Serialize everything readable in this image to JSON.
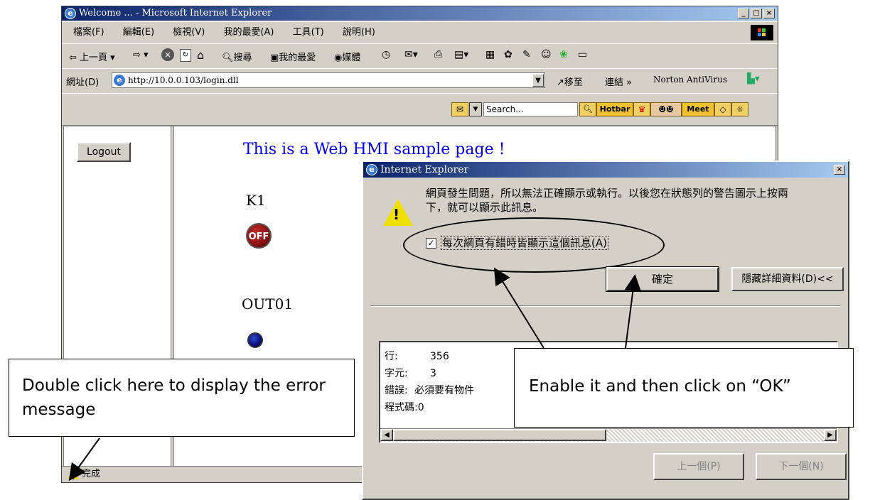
{
  "browser": {
    "title": "Welcome ... - Microsoft Internet Explorer",
    "menu": [
      "檔案(F)",
      "編輯(E)",
      "檢視(V)",
      "我的最愛(A)",
      "工具(T)",
      "說明(H)"
    ],
    "toolbar": {
      "back": "上一頁",
      "search": "搜尋",
      "favorites": "我的最愛",
      "media": "媒體"
    },
    "address": {
      "label": "網址(D)",
      "url": "http://10.0.0.103/login.dll",
      "go": "移至",
      "links": "連結",
      "links_more": "»",
      "norton": "Norton AntiVirus"
    },
    "search_bar": {
      "placeholder": "Search...",
      "hotbar": "Hotbar",
      "meet": "Meet"
    },
    "status": "完成"
  },
  "page": {
    "logout": "Logout",
    "heading": "This is a Web HMI sample page !",
    "k1_label": "K1",
    "k1_button": "OFF",
    "out_label": "OUT01"
  },
  "dialog": {
    "title": "Internet Explorer",
    "close": "×",
    "message_line1": "網頁發生問題，所以無法正確顯示或執行。以後您在狀態列的警告圖示上按兩",
    "message_line2": "下，就可以顯示此訊息。",
    "checkbox_label": "每次網頁有錯時皆顯示這個訊息(A)",
    "checkbox_checked": true,
    "ok_button": "確定",
    "details_button": "隱藏詳細資料(D)<<",
    "details": [
      {
        "label": "行:",
        "value": "356"
      },
      {
        "label": "字元:",
        "value": "3"
      },
      {
        "label": "錯誤:",
        "value": "必須要有物件"
      },
      {
        "label": "程式碼:",
        "value": "0"
      }
    ],
    "prev_button": "上一個(P)",
    "next_button": "下一個(N)"
  },
  "callouts": {
    "left": "Double click here to display the error message",
    "right": "Enable it and then click on “OK”"
  },
  "colors": {
    "title_gradient_start": "#0a246a",
    "title_gradient_end": "#a6caf0",
    "heading": "#0000ee",
    "off_button": "#8b1010",
    "out_indicator": "#0a0a7a"
  }
}
